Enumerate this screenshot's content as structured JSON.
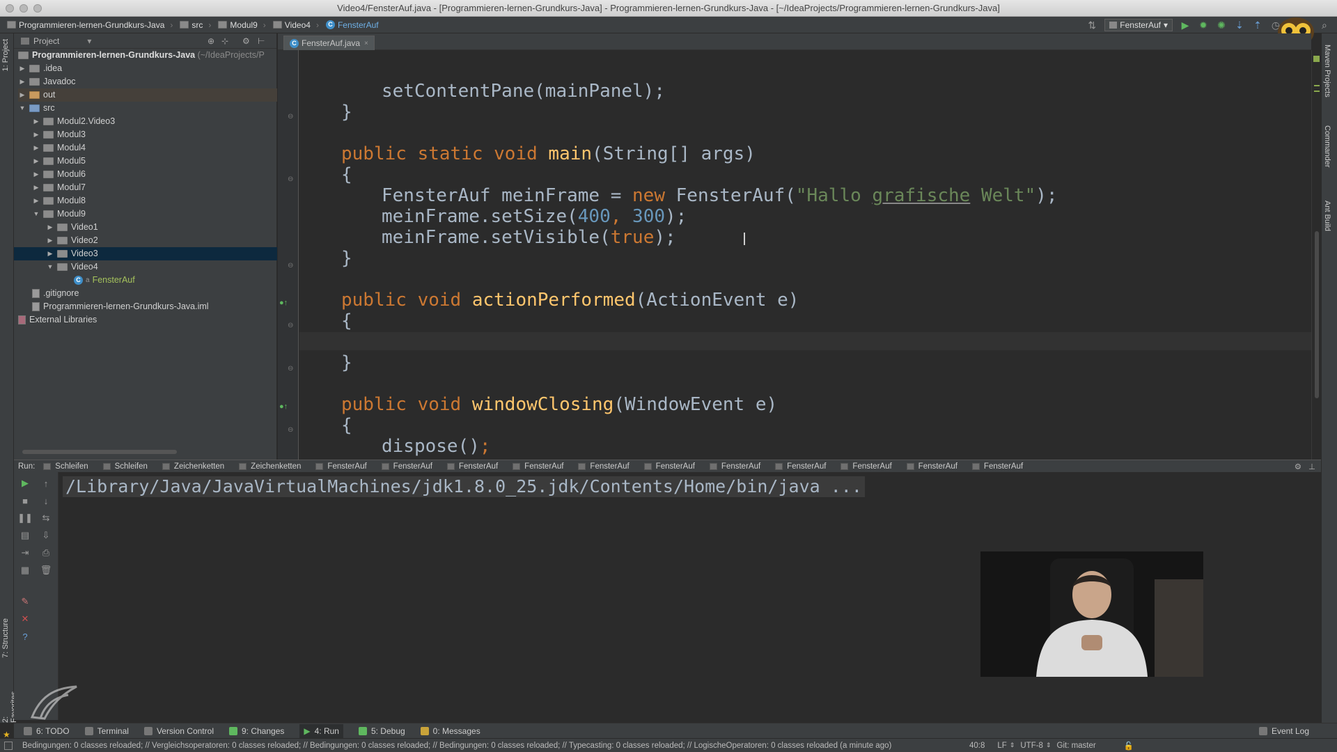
{
  "window": {
    "title": "Video4/FensterAuf.java - [Programmieren-lernen-Grundkurs-Java] - Programmieren-lernen-Grundkurs-Java - [~/IdeaProjects/Programmieren-lernen-Grundkurs-Java]"
  },
  "breadcrumb": [
    "Programmieren-lernen-Grundkurs-Java",
    "src",
    "Modul9",
    "Video4",
    "FensterAuf"
  ],
  "run_config": "FensterAuf",
  "left_strip": {
    "project": "1: Project",
    "structure": "7: Structure",
    "favorites": "2: Favorites"
  },
  "right_strip": {
    "maven": "Maven Projects",
    "commander": "Commander",
    "ant": "Ant Build"
  },
  "project_panel": {
    "title": "Project",
    "root": "Programmieren-lernen-Grundkurs-Java",
    "root_path": "(~/IdeaProjects/P",
    "items": [
      {
        "label": ".idea"
      },
      {
        "label": "Javadoc"
      },
      {
        "label": "out"
      },
      {
        "label": "src"
      },
      {
        "label": "Modul2.Video3"
      },
      {
        "label": "Modul3"
      },
      {
        "label": "Modul4"
      },
      {
        "label": "Modul5"
      },
      {
        "label": "Modul6"
      },
      {
        "label": "Modul7"
      },
      {
        "label": "Modul8"
      },
      {
        "label": "Modul9"
      },
      {
        "label": "Video1"
      },
      {
        "label": "Video2"
      },
      {
        "label": "Video3"
      },
      {
        "label": "Video4"
      },
      {
        "label": "FensterAuf"
      },
      {
        "label": ".gitignore"
      },
      {
        "label": "Programmieren-lernen-Grundkurs-Java.iml"
      },
      {
        "label": "External Libraries"
      }
    ]
  },
  "editor": {
    "tab": "FensterAuf.java",
    "code": {
      "l1": "setContentPane(mainPanel);",
      "l2": "}",
      "l3a": "public static void ",
      "l3b": "main",
      "l3c": "(String[] args)",
      "l4": "{",
      "l5a": "FensterAuf meinFrame = ",
      "l5b": "new ",
      "l5c": "FensterAuf(",
      "l5d": "\"Hallo ",
      "l5e": "grafische",
      "l5f": " Welt\"",
      "l5g": ");",
      "l6a": "meinFrame.setSize(",
      "l6b": "400",
      "l6c": ", ",
      "l6d": "300",
      "l6e": ");",
      "l7a": "meinFrame.setVisible(",
      "l7b": "true",
      "l7c": ");",
      "l8": "}",
      "l9a": "public void ",
      "l9b": "actionPerformed",
      "l9c": "(ActionEvent e)",
      "l10": "{",
      "l11": "}",
      "l12a": "public void ",
      "l12b": "windowClosing",
      "l12c": "(WindowEvent e)",
      "l13": "{",
      "l14a": "dispose()",
      "l14b": ";"
    }
  },
  "run_panel": {
    "label": "Run:",
    "tabs": [
      "Schleifen",
      "Schleifen",
      "Zeichenketten",
      "Zeichenketten",
      "FensterAuf",
      "FensterAuf",
      "FensterAuf",
      "FensterAuf",
      "FensterAuf",
      "FensterAuf",
      "FensterAuf",
      "FensterAuf",
      "FensterAuf",
      "FensterAuf",
      "FensterAuf"
    ],
    "console_line": "/Library/Java/JavaVirtualMachines/jdk1.8.0_25.jdk/Contents/Home/bin/java ..."
  },
  "bottom_tools": [
    "6: TODO",
    "Terminal",
    "Version Control",
    "9: Changes",
    "4: Run",
    "5: Debug",
    "0: Messages"
  ],
  "event_log": "Event Log",
  "status": {
    "message": "Bedingungen: 0 classes reloaded; // Vergleichsoperatoren: 0 classes reloaded; // Bedingungen: 0 classes reloaded; // Bedingungen: 0 classes reloaded; // Typecasting: 0 classes reloaded; // LogischeOperatoren: 0 classes reloaded (a minute ago)",
    "position": "40:8",
    "line_sep": "LF",
    "encoding": "UTF-8",
    "git": "Git: master"
  },
  "colors": {
    "keyword": "#cc7832",
    "function": "#ffc66d",
    "string": "#6a8759",
    "number": "#6897bb",
    "selection": "#0d293e"
  }
}
